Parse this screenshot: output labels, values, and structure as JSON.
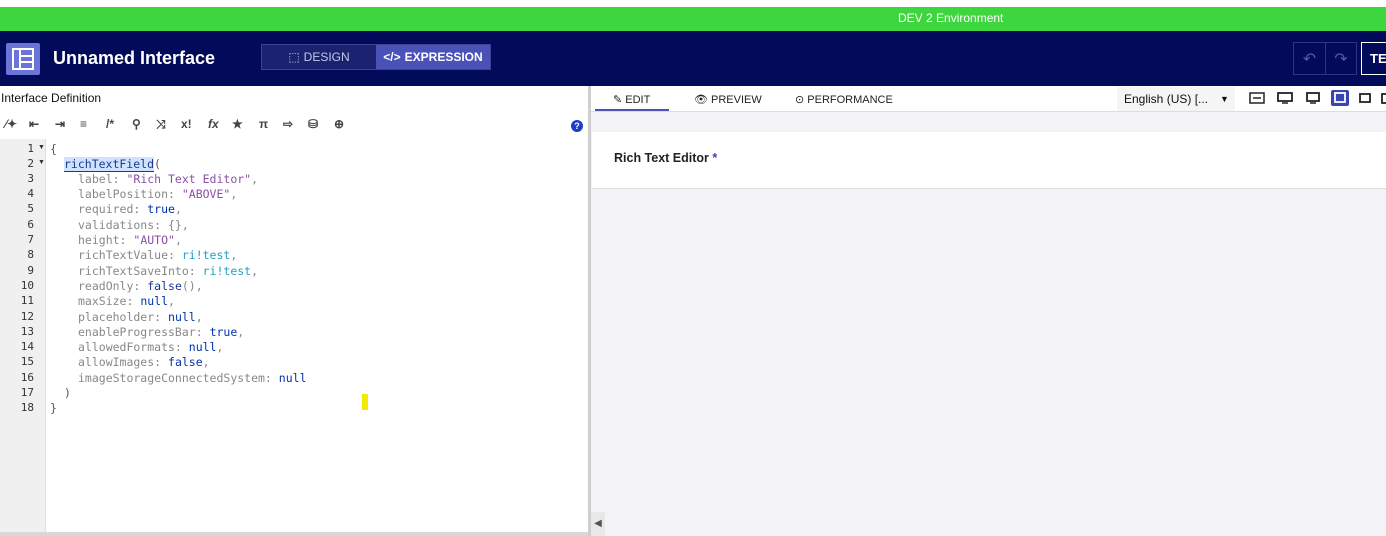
{
  "environment": {
    "label": "DEV 2 Environment"
  },
  "header": {
    "title": "Unnamed Interface",
    "modes": {
      "design": "DESIGN",
      "expression": "EXPRESSION"
    },
    "test_label": "TE"
  },
  "left_panel": {
    "title": "Interface Definition",
    "toolbar": [
      "/*",
      "x!",
      "fx",
      "π"
    ],
    "code_lines": [
      {
        "n": "1",
        "fold": true
      },
      {
        "n": "2",
        "fold": true
      },
      {
        "n": "3"
      },
      {
        "n": "4"
      },
      {
        "n": "5"
      },
      {
        "n": "6"
      },
      {
        "n": "7"
      },
      {
        "n": "8"
      },
      {
        "n": "9"
      },
      {
        "n": "10"
      },
      {
        "n": "11"
      },
      {
        "n": "12"
      },
      {
        "n": "13"
      },
      {
        "n": "14"
      },
      {
        "n": "15"
      },
      {
        "n": "16"
      },
      {
        "n": "17"
      },
      {
        "n": "18"
      }
    ],
    "code": {
      "l1": "{",
      "l2_fn": "richTextField",
      "l2_rest": "(",
      "l3_key": "label: ",
      "l3_val": "\"Rich Text Editor\"",
      "l3_end": ",",
      "l4_key": "labelPosition: ",
      "l4_val": "\"ABOVE\"",
      "l4_end": ",",
      "l5_key": "required: ",
      "l5_val": "true",
      "l5_end": ",",
      "l6_key": "validations: {},",
      "l7_key": "height: ",
      "l7_val": "\"AUTO\"",
      "l7_end": ",",
      "l8_key": "richTextValue: ",
      "l8_val": "ri!test",
      "l8_end": ",",
      "l9_key": "richTextSaveInto: ",
      "l9_val": "ri!test",
      "l9_end": ",",
      "l10_key": "readOnly: ",
      "l10_val": "false",
      "l10_end": "(),",
      "l11_key": "maxSize: ",
      "l11_val": "null",
      "l11_end": ",",
      "l12_key": "placeholder: ",
      "l12_val": "null",
      "l12_end": ",",
      "l13_key": "enableProgressBar: ",
      "l13_val": "true",
      "l13_end": ",",
      "l14_key": "allowedFormats: ",
      "l14_val": "null",
      "l14_end": ",",
      "l15_key": "allowImages: ",
      "l15_val": "false",
      "l15_end": ",",
      "l16_key": "imageStorageConnectedSystem: ",
      "l16_val": "null",
      "l17": ")",
      "l18": "}"
    }
  },
  "right_panel": {
    "tabs": {
      "edit": "EDIT",
      "preview": "PREVIEW",
      "performance": "PERFORMANCE"
    },
    "locale": "English (US) [...",
    "field": {
      "label": "Rich Text Editor",
      "required_mark": "*"
    }
  },
  "colors": {
    "env_green": "#3ed63e",
    "header_navy": "#020a5a",
    "accent": "#4a52b8"
  }
}
